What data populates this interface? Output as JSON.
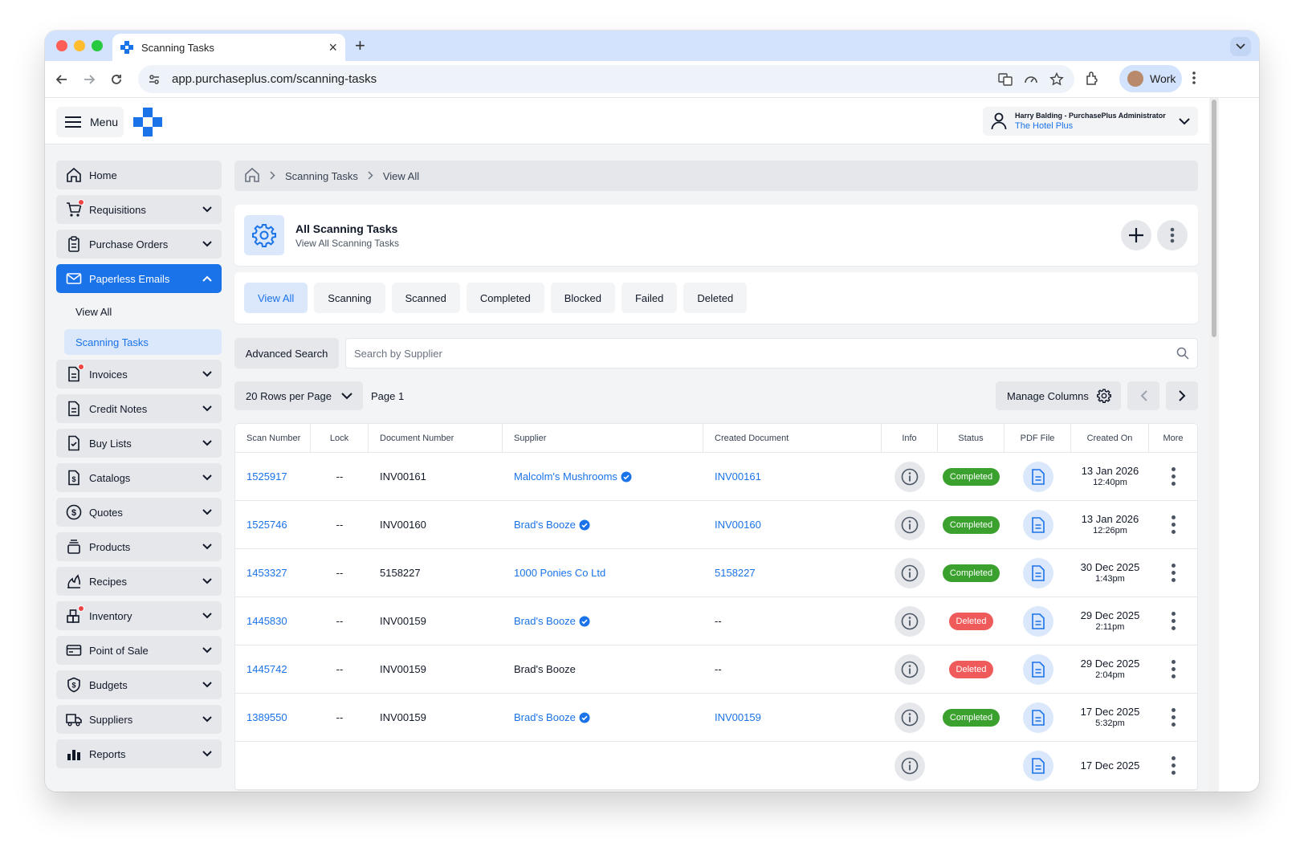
{
  "browser": {
    "tab_title": "Scanning Tasks",
    "url": "app.purchaseplus.com/scanning-tasks",
    "profile_label": "Work"
  },
  "app": {
    "menu_label": "Menu",
    "user": {
      "name": "Harry Balding - PurchasePlus Administrator",
      "org": "The Hotel Plus"
    },
    "colors": {
      "primary": "#1a73e8",
      "completed": "#3aa12e",
      "deleted": "#ef5b5b"
    }
  },
  "sidebar": {
    "items": [
      {
        "label": "Home",
        "icon": "home-icon"
      },
      {
        "label": "Requisitions",
        "icon": "cart-icon"
      },
      {
        "label": "Purchase Orders",
        "icon": "clipboard-icon"
      },
      {
        "label": "Paperless Emails",
        "icon": "envelope-icon"
      },
      {
        "label": "Invoices",
        "icon": "invoice-icon"
      },
      {
        "label": "Credit Notes",
        "icon": "document-icon"
      },
      {
        "label": "Buy Lists",
        "icon": "checklist-icon"
      },
      {
        "label": "Catalogs",
        "icon": "dollar-document-icon"
      },
      {
        "label": "Quotes",
        "icon": "dollar-circle-icon"
      },
      {
        "label": "Products",
        "icon": "stack-icon"
      },
      {
        "label": "Recipes",
        "icon": "flame-icon"
      },
      {
        "label": "Inventory",
        "icon": "boxes-icon"
      },
      {
        "label": "Point of Sale",
        "icon": "card-icon"
      },
      {
        "label": "Budgets",
        "icon": "shield-dollar-icon"
      },
      {
        "label": "Suppliers",
        "icon": "truck-icon"
      },
      {
        "label": "Reports",
        "icon": "bar-chart-icon"
      }
    ],
    "sub_items": [
      {
        "label": "View All"
      },
      {
        "label": "Scanning Tasks"
      }
    ]
  },
  "breadcrumb": {
    "level1": "Scanning Tasks",
    "level2": "View All"
  },
  "header": {
    "title": "All Scanning Tasks",
    "subtitle": "View All Scanning Tasks"
  },
  "filters": [
    "View All",
    "Scanning",
    "Scanned",
    "Completed",
    "Blocked",
    "Failed",
    "Deleted"
  ],
  "search": {
    "advanced_label": "Advanced Search",
    "placeholder": "Search by Supplier"
  },
  "pager": {
    "rows_label": "20 Rows per Page",
    "page_label": "Page 1",
    "manage_columns": "Manage Columns"
  },
  "table": {
    "columns": [
      "Scan Number",
      "Lock",
      "Document Number",
      "Supplier",
      "Created Document",
      "Info",
      "Status",
      "PDF File",
      "Created On",
      "More"
    ],
    "rows": [
      {
        "scan": "1525917",
        "lock": "--",
        "doc": "INV00161",
        "supplier": "Malcolm's Mushrooms",
        "created_doc": "INV00161",
        "status": "Completed",
        "date": "13 Jan 2026",
        "time": "12:40pm"
      },
      {
        "scan": "1525746",
        "lock": "--",
        "doc": "INV00160",
        "supplier": "Brad's Booze",
        "created_doc": "INV00160",
        "status": "Completed",
        "date": "13 Jan 2026",
        "time": "12:26pm"
      },
      {
        "scan": "1453327",
        "lock": "--",
        "doc": "5158227",
        "supplier": "1000 Ponies Co Ltd",
        "created_doc": "5158227",
        "status": "Completed",
        "date": "30 Dec 2025",
        "time": "1:43pm"
      },
      {
        "scan": "1445830",
        "lock": "--",
        "doc": "INV00159",
        "supplier": "Brad's Booze",
        "created_doc": "--",
        "status": "Deleted",
        "date": "29 Dec 2025",
        "time": "2:11pm"
      },
      {
        "scan": "1445742",
        "lock": "--",
        "doc": "INV00159",
        "supplier": "Brad's Booze",
        "created_doc": "--",
        "status": "Deleted",
        "date": "29 Dec 2025",
        "time": "2:04pm"
      },
      {
        "scan": "1389550",
        "lock": "--",
        "doc": "INV00159",
        "supplier": "Brad's Booze",
        "created_doc": "INV00159",
        "status": "Completed",
        "date": "17 Dec 2025",
        "time": "5:32pm"
      },
      {
        "scan": "",
        "lock": "",
        "doc": "",
        "supplier": "",
        "created_doc": "",
        "status": "",
        "date": "17 Dec 2025",
        "time": ""
      }
    ]
  }
}
